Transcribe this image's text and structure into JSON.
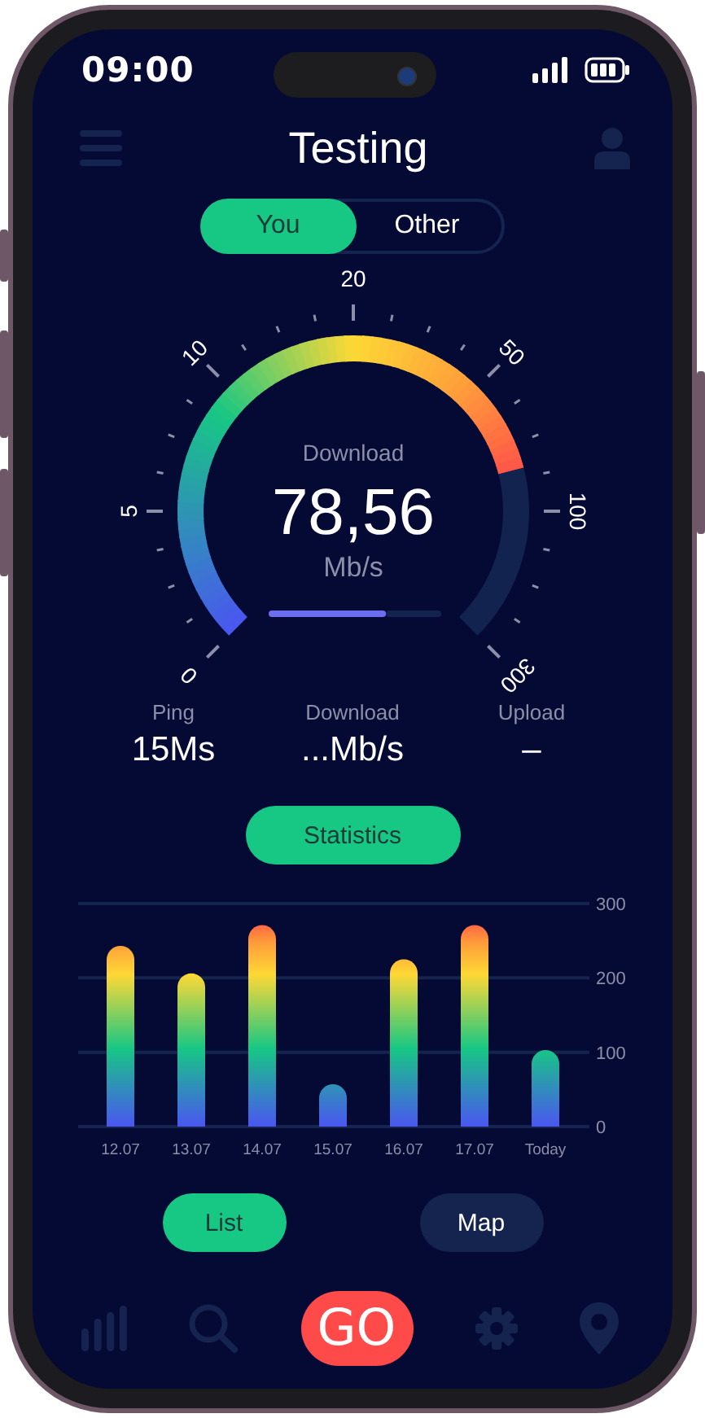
{
  "status_bar": {
    "time": "09:00"
  },
  "header": {
    "title": "Testing"
  },
  "tabs": [
    {
      "label": "You",
      "selected": true
    },
    {
      "label": "Other",
      "selected": false
    }
  ],
  "gauge": {
    "scale": [
      "0",
      "5",
      "10",
      "20",
      "50",
      "100",
      "300"
    ],
    "caption": "Download",
    "value": "78,56",
    "unit": "Mb/s"
  },
  "stats": [
    {
      "label": "Ping",
      "value": "15Ms"
    },
    {
      "label": "Download",
      "value": "...Mb/s"
    },
    {
      "label": "Upload",
      "value": "–"
    }
  ],
  "statistics": {
    "button": "Statistics",
    "chart_data": {
      "type": "bar",
      "categories": [
        "12.07",
        "13.07",
        "14.07",
        "15.07",
        "16.07",
        "17.07",
        "Today"
      ],
      "values": [
        243,
        206,
        271,
        57,
        225,
        271,
        103
      ],
      "ylim": [
        0,
        300
      ],
      "yticks": [
        0,
        100,
        200,
        300
      ]
    }
  },
  "view_buttons": [
    {
      "label": "List",
      "selected": true
    },
    {
      "label": "Map",
      "selected": false
    }
  ],
  "nav": {
    "go": "GO"
  }
}
